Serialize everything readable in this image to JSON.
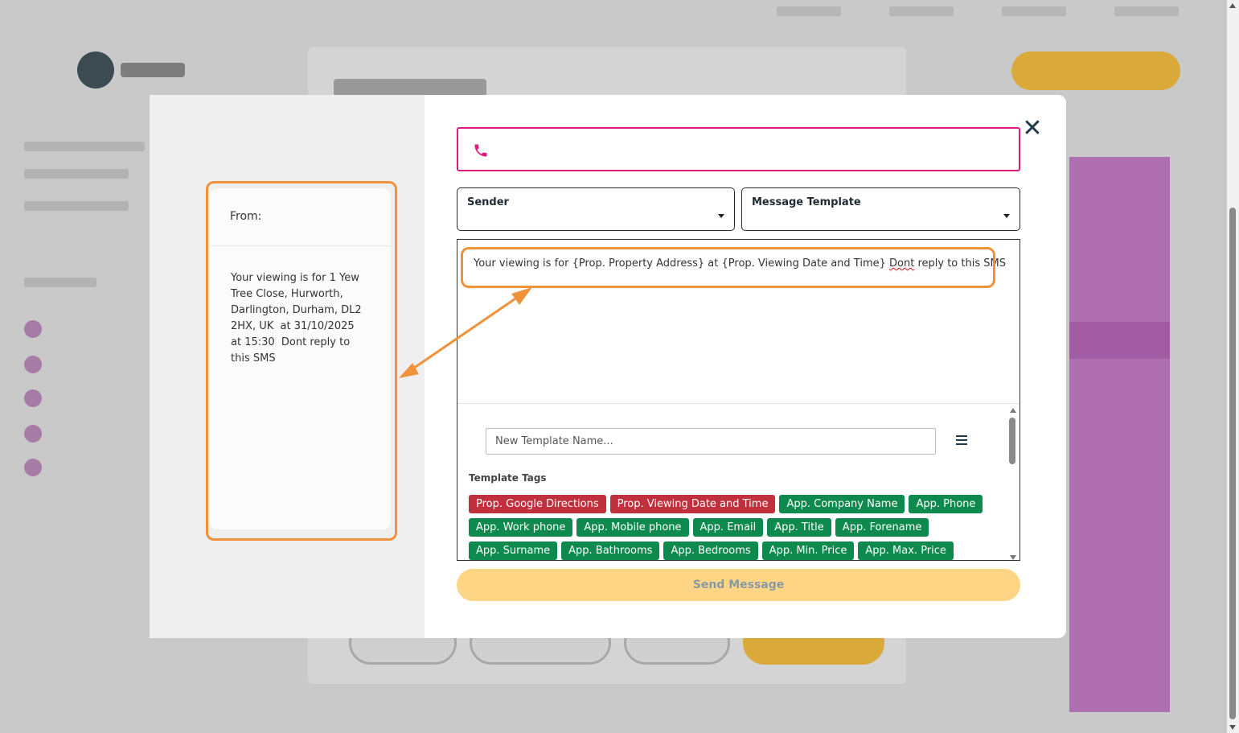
{
  "preview": {
    "from_label": "From:",
    "message": "Your viewing is for 1 Yew Tree Close, Hurworth, Darlington, Durham, DL2 2HX, UK  at 31/10/2025 at 15:30  Dont reply to this SMS"
  },
  "close": {
    "symbol": "✕"
  },
  "phone_input": {
    "value": "",
    "placeholder": ""
  },
  "sender": {
    "label": "Sender"
  },
  "template_select": {
    "label": "Message Template"
  },
  "editor": {
    "text_before": "Your viewing is for {Prop. Property Address} at {Prop. Viewing Date and Time} ",
    "text_typo": "Dont",
    "text_after": " reply to this SMS"
  },
  "template_name": {
    "placeholder": "New Template Name..."
  },
  "tags_heading": "Template Tags",
  "tags": [
    {
      "label": "Prop. Google Directions",
      "color": "red"
    },
    {
      "label": "Prop. Viewing Date and Time",
      "color": "red"
    },
    {
      "label": "App. Company Name",
      "color": "green"
    },
    {
      "label": "App. Phone",
      "color": "green"
    },
    {
      "label": "App. Work phone",
      "color": "green"
    },
    {
      "label": "App. Mobile phone",
      "color": "green"
    },
    {
      "label": "App. Email",
      "color": "green"
    },
    {
      "label": "App. Title",
      "color": "green"
    },
    {
      "label": "App. Forename",
      "color": "green"
    },
    {
      "label": "App. Surname",
      "color": "green"
    },
    {
      "label": "App. Bathrooms",
      "color": "green"
    },
    {
      "label": "App. Bedrooms",
      "color": "green"
    },
    {
      "label": "App. Min. Price",
      "color": "green"
    },
    {
      "label": "App. Max. Price",
      "color": "green"
    }
  ],
  "send_button": {
    "label": "Send Message"
  },
  "colors": {
    "phone_border": "#e0197f",
    "tag_red": "#c0303d",
    "tag_green": "#0f8a4e",
    "send_bg": "#fdd584",
    "annotation": "#f0923a"
  },
  "icons": {
    "close": "close-icon",
    "phone": "phone-icon",
    "menu": "hamburger-menu-icon",
    "caret": "caret-down-icon"
  }
}
